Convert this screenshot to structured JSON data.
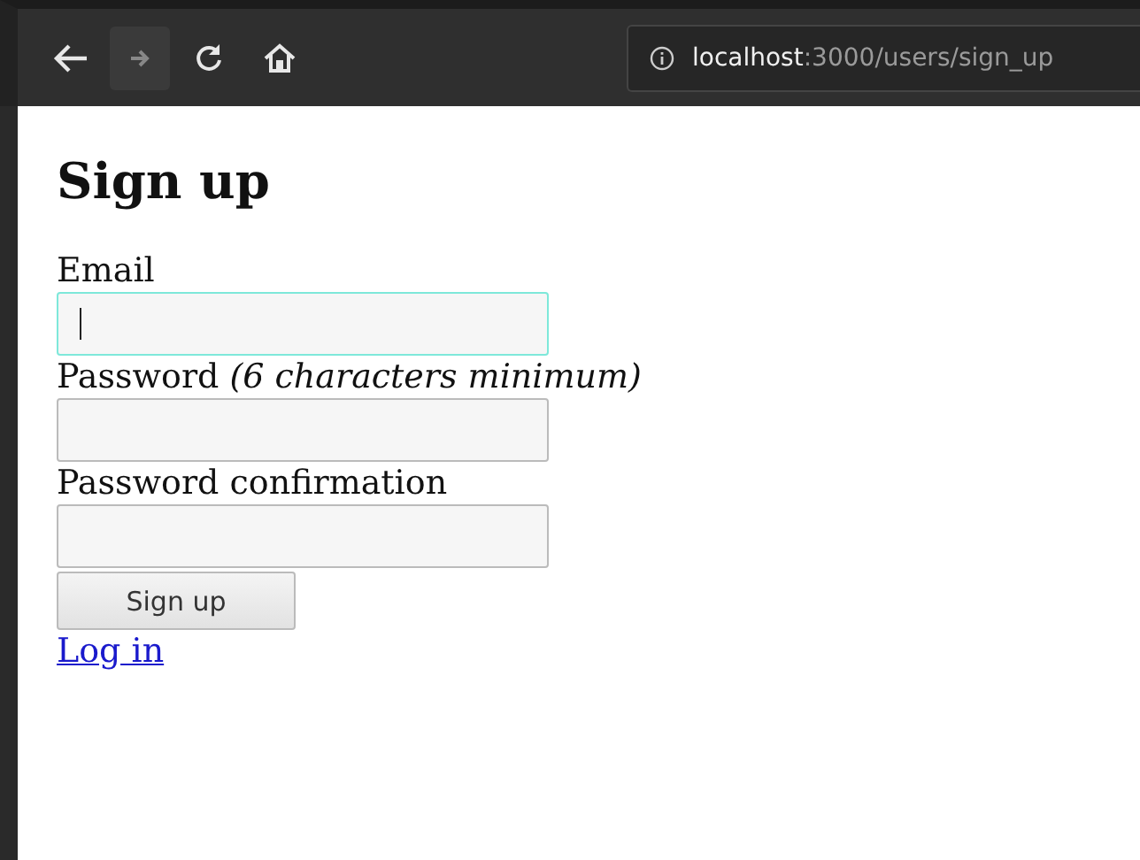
{
  "toolbar": {
    "back": {
      "disabled": false
    },
    "forward": {
      "disabled": true
    },
    "url_host": "localhost",
    "url_path": ":3000/users/sign_up"
  },
  "heading": "Sign up",
  "fields": [
    {
      "label": "Email",
      "focused": true
    },
    {
      "label": "Password *(6 characters minimum)*",
      "focused": false
    },
    {
      "label": "Password confirmation",
      "focused": false
    }
  ],
  "submit": "Sign up",
  "link": "Log in"
}
